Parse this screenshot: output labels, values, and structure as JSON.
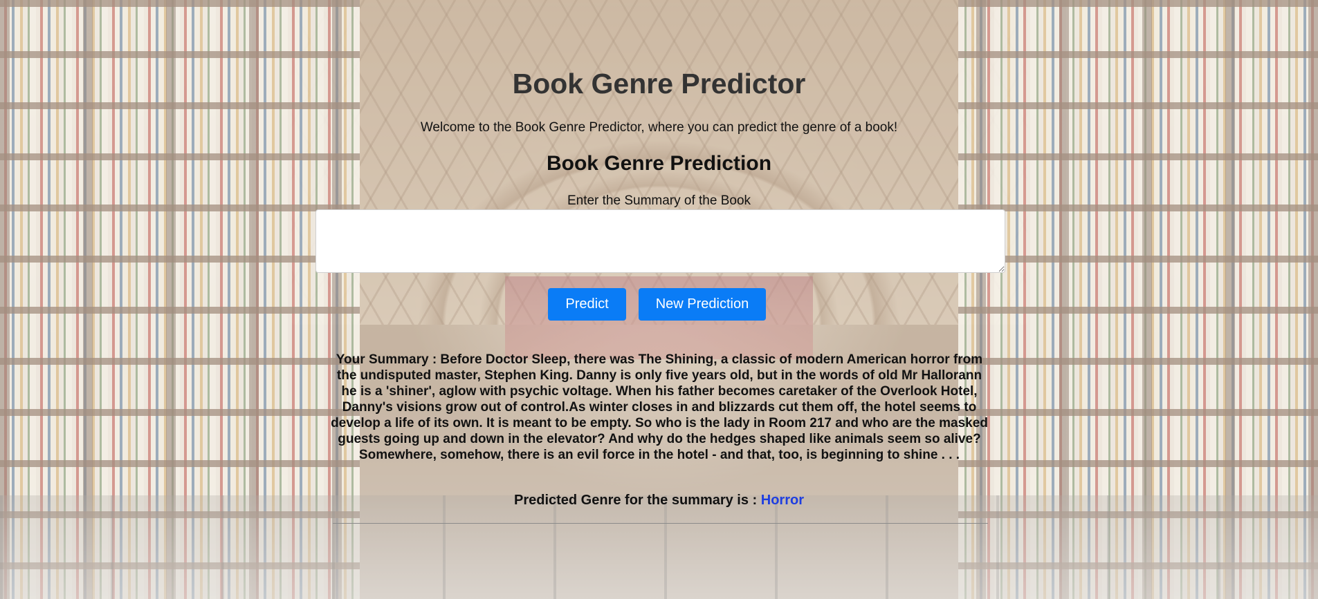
{
  "page": {
    "title": "Book Genre Predictor",
    "welcome": "Welcome to the Book Genre Predictor, where you can predict the genre of a book!"
  },
  "form": {
    "heading": "Book Genre Prediction",
    "summary_label": "Enter the Summary of the Book",
    "summary_value": "",
    "summary_placeholder": "",
    "predict_label": "Predict",
    "new_prediction_label": "New Prediction"
  },
  "result": {
    "summary_text": "Your Summary : Before Doctor Sleep, there was The Shining, a classic of modern American horror from the undisputed master, Stephen King. Danny is only five years old, but in the words of old Mr Hallorann he is a 'shiner', aglow with psychic voltage. When his father becomes caretaker of the Overlook Hotel, Danny's visions grow out of control.As winter closes in and blizzards cut them off, the hotel seems to develop a life of its own. It is meant to be empty. So who is the lady in Room 217 and who are the masked guests going up and down in the elevator? And why do the hedges shaped like animals seem so alive?Somewhere, somehow, there is an evil force in the hotel - and that, too, is beginning to shine . . .",
    "prediction_label": "Predicted Genre for the summary is : ",
    "predicted_genre": "Horror"
  },
  "colors": {
    "button": "#0a7cf6",
    "genre": "#1e3ee0",
    "title": "#333333"
  }
}
